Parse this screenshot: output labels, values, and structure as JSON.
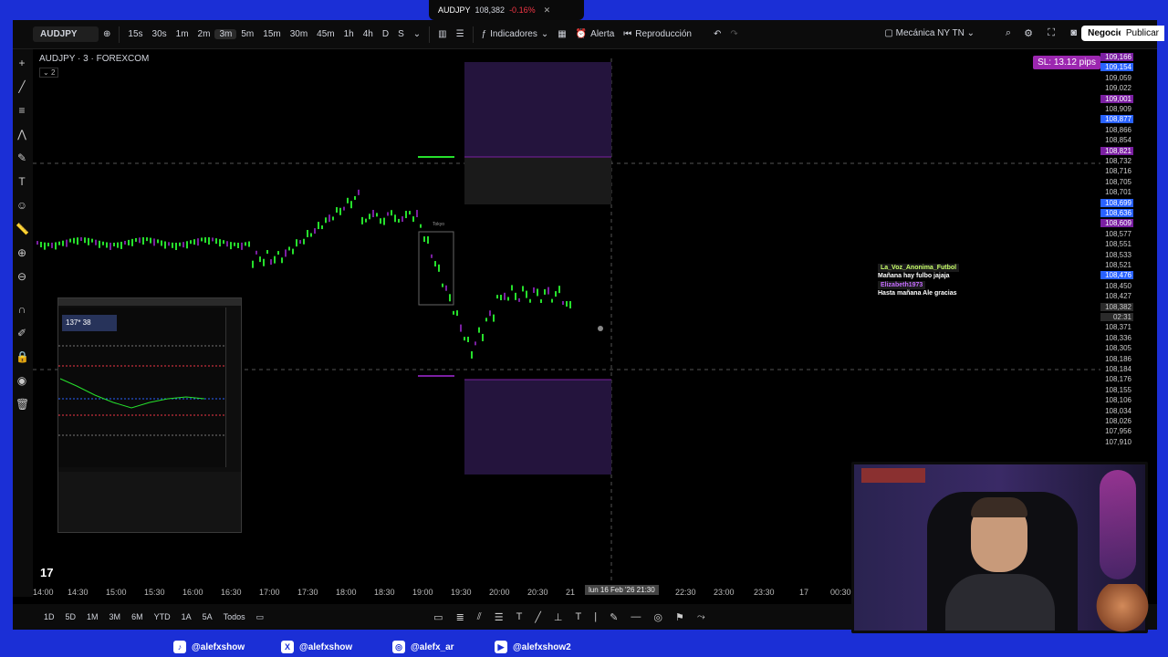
{
  "browser": {
    "tab_symbol": "AUDJPY",
    "tab_price": "108,382",
    "tab_change": "-0.16%"
  },
  "toolbar": {
    "symbol": "AUDJPY",
    "intervals": [
      "15s",
      "30s",
      "1m",
      "2m",
      "3m",
      "5m",
      "15m",
      "30m",
      "45m",
      "1h",
      "4h",
      "D",
      "S"
    ],
    "active_interval": "3m",
    "indicators_label": "Indicadores",
    "alert_label": "Alerta",
    "replay_label": "Reproducción",
    "layout_name": "Mecánica NY TN",
    "trade_label": "Negocie",
    "publish_label": "Publicar"
  },
  "chart": {
    "title": "AUDJPY · 3 · FOREXCOM",
    "collapse_count": "2",
    "sl_badge": "SL: 13.12 pips",
    "colors": {
      "up": "#26e02c",
      "down": "#7b1fa2",
      "zone": "#2a1846"
    }
  },
  "price_axis": [
    {
      "v": "109,166",
      "style": "purple"
    },
    {
      "v": "109,154",
      "style": "blue"
    },
    {
      "v": "109,059",
      "style": ""
    },
    {
      "v": "109,022",
      "style": ""
    },
    {
      "v": "109,001",
      "style": "purple"
    },
    {
      "v": "108,909",
      "style": ""
    },
    {
      "v": "108,877",
      "style": "blue"
    },
    {
      "v": "108,866",
      "style": ""
    },
    {
      "v": "108,854",
      "style": ""
    },
    {
      "v": "108,821",
      "style": "purple"
    },
    {
      "v": "108,732",
      "style": ""
    },
    {
      "v": "108,716",
      "style": ""
    },
    {
      "v": "108,705",
      "style": ""
    },
    {
      "v": "108,701",
      "style": ""
    },
    {
      "v": "108,699",
      "style": "blue"
    },
    {
      "v": "108,636",
      "style": "blue"
    },
    {
      "v": "108,609",
      "style": "purple"
    },
    {
      "v": "108,577",
      "style": ""
    },
    {
      "v": "108,551",
      "style": ""
    },
    {
      "v": "108,533",
      "style": ""
    },
    {
      "v": "108,521",
      "style": ""
    },
    {
      "v": "108,476",
      "style": "blue"
    },
    {
      "v": "108,450",
      "style": ""
    },
    {
      "v": "108,427",
      "style": ""
    },
    {
      "v": "108,382",
      "style": "gray"
    },
    {
      "v": "02:31",
      "style": "gray"
    },
    {
      "v": "108,371",
      "style": ""
    },
    {
      "v": "108,336",
      "style": ""
    },
    {
      "v": "108,305",
      "style": ""
    },
    {
      "v": "108,186",
      "style": ""
    },
    {
      "v": "108,184",
      "style": ""
    },
    {
      "v": "108,176",
      "style": ""
    },
    {
      "v": "108,155",
      "style": ""
    },
    {
      "v": "108,106",
      "style": ""
    },
    {
      "v": "108,034",
      "style": ""
    },
    {
      "v": "108,026",
      "style": ""
    },
    {
      "v": "107,956",
      "style": ""
    },
    {
      "v": "107,910",
      "style": ""
    }
  ],
  "time_axis": {
    "ticks": [
      "14:00",
      "14:30",
      "15:00",
      "15:30",
      "16:00",
      "16:30",
      "17:00",
      "17:30",
      "18:00",
      "18:30",
      "19:00",
      "19:30",
      "20:00",
      "20:30",
      "21",
      "22:30",
      "23:00",
      "23:30",
      "17",
      "00:30"
    ],
    "cursor": "lun 16 Feb '26  21:30"
  },
  "bottombar": {
    "ranges": [
      "1D",
      "5D",
      "1M",
      "3M",
      "6M",
      "YTD",
      "1A",
      "5A",
      "Todos"
    ]
  },
  "mini_window": {
    "box_text": "137*  38"
  },
  "chat": [
    {
      "user": "La_Voz_Anonima_Futbol",
      "msg": "Mañana hay fulbo jajaja",
      "color": "#c8ff6a"
    },
    {
      "user": "Elizabeth1973",
      "msg": "Hasta mañana Ale gracias",
      "color": "#c56cff"
    }
  ],
  "socials": [
    {
      "icon": "tiktok-icon",
      "glyph": "♪",
      "handle": "@alefxshow"
    },
    {
      "icon": "x-icon",
      "glyph": "X",
      "handle": "@alefxshow"
    },
    {
      "icon": "instagram-icon",
      "glyph": "◎",
      "handle": "@alefx_ar"
    },
    {
      "icon": "youtube-icon",
      "glyph": "▶",
      "handle": "@alefxshow2"
    }
  ],
  "logo": "17"
}
